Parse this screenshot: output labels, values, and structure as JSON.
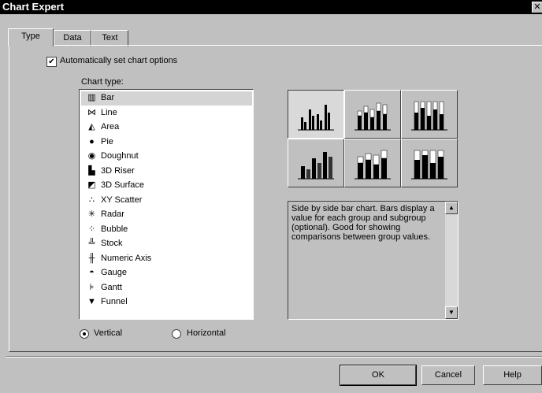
{
  "window": {
    "title": "Chart Expert",
    "close_glyph": "✕"
  },
  "tabs": [
    {
      "label": "Type"
    },
    {
      "label": "Data"
    },
    {
      "label": "Text"
    }
  ],
  "options": {
    "auto_label": "Automatically set chart options",
    "auto_checked": true,
    "check_glyph": "✔"
  },
  "chart_type": {
    "label": "Chart type:",
    "selected": "Bar",
    "items": [
      {
        "label": "Bar",
        "icon": "bar-chart-icon",
        "glyph": "▥"
      },
      {
        "label": "Line",
        "icon": "line-chart-icon",
        "glyph": "⋈"
      },
      {
        "label": "Area",
        "icon": "area-chart-icon",
        "glyph": "◭"
      },
      {
        "label": "Pie",
        "icon": "pie-chart-icon",
        "glyph": "●"
      },
      {
        "label": "Doughnut",
        "icon": "doughnut-chart-icon",
        "glyph": "◉"
      },
      {
        "label": "3D Riser",
        "icon": "3d-riser-icon",
        "glyph": "▙"
      },
      {
        "label": "3D Surface",
        "icon": "3d-surface-icon",
        "glyph": "◩"
      },
      {
        "label": "XY Scatter",
        "icon": "xy-scatter-icon",
        "glyph": "∴"
      },
      {
        "label": "Radar",
        "icon": "radar-icon",
        "glyph": "✳"
      },
      {
        "label": "Bubble",
        "icon": "bubble-icon",
        "glyph": "⁘"
      },
      {
        "label": "Stock",
        "icon": "stock-icon",
        "glyph": "╩"
      },
      {
        "label": "Numeric Axis",
        "icon": "numeric-axis-icon",
        "glyph": "╫"
      },
      {
        "label": "Gauge",
        "icon": "gauge-icon",
        "glyph": "◓"
      },
      {
        "label": "Gantt",
        "icon": "gantt-icon",
        "glyph": "⊧"
      },
      {
        "label": "Funnel",
        "icon": "funnel-icon",
        "glyph": "▼"
      }
    ]
  },
  "subtypes": [
    {
      "name": "side-by-side-bar",
      "selected": true
    },
    {
      "name": "stacked-bar",
      "selected": false
    },
    {
      "name": "percent-bar",
      "selected": false
    },
    {
      "name": "3d-side-by-side-bar",
      "selected": false
    },
    {
      "name": "3d-stacked-bar",
      "selected": false
    },
    {
      "name": "3d-percent-bar",
      "selected": false
    }
  ],
  "description": "Side by side bar chart. Bars display a value for each group and subgroup (optional). Good for showing comparisons between group values.",
  "orientation": {
    "vertical_label": "Vertical",
    "horizontal_label": "Horizontal",
    "selected": "Vertical"
  },
  "buttons": {
    "ok": "OK",
    "cancel": "Cancel",
    "help": "Help"
  },
  "scroll": {
    "up": "▲",
    "down": "▼"
  }
}
